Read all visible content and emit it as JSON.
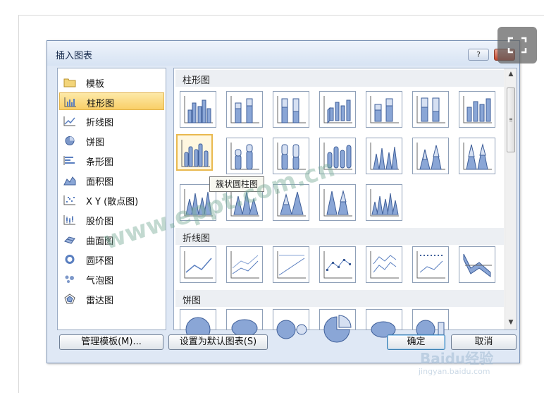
{
  "dialog": {
    "title": "插入图表",
    "help_label": "?",
    "close_label": "×"
  },
  "categories": [
    {
      "label": "模板",
      "icon": "folder-icon"
    },
    {
      "label": "柱形图",
      "icon": "column-chart-icon",
      "selected": true
    },
    {
      "label": "折线图",
      "icon": "line-chart-icon"
    },
    {
      "label": "饼图",
      "icon": "pie-chart-icon"
    },
    {
      "label": "条形图",
      "icon": "bar-chart-icon"
    },
    {
      "label": "面积图",
      "icon": "area-chart-icon"
    },
    {
      "label": "X Y (散点图)",
      "icon": "scatter-chart-icon"
    },
    {
      "label": "股价图",
      "icon": "stock-chart-icon"
    },
    {
      "label": "曲面图",
      "icon": "surface-chart-icon"
    },
    {
      "label": "圆环图",
      "icon": "doughnut-chart-icon"
    },
    {
      "label": "气泡图",
      "icon": "bubble-chart-icon"
    },
    {
      "label": "雷达图",
      "icon": "radar-chart-icon"
    }
  ],
  "sections": {
    "column": "柱形图",
    "line": "折线图",
    "pie": "饼图"
  },
  "tooltip": "簇状圆柱图",
  "buttons": {
    "manage_templates": "管理模板(M)...",
    "set_default": "设置为默认图表(S)",
    "ok": "确定",
    "cancel": "取消"
  },
  "watermarks": {
    "site": "www.eppt.com.cn",
    "baidu": "Baidu经验",
    "baidu_url": "jingyan.baidu.com"
  },
  "colors": {
    "accent_blue": "#6b8fc7",
    "selection_gold": "#f9cf67",
    "dialog_bg": "#dfe8f5"
  }
}
